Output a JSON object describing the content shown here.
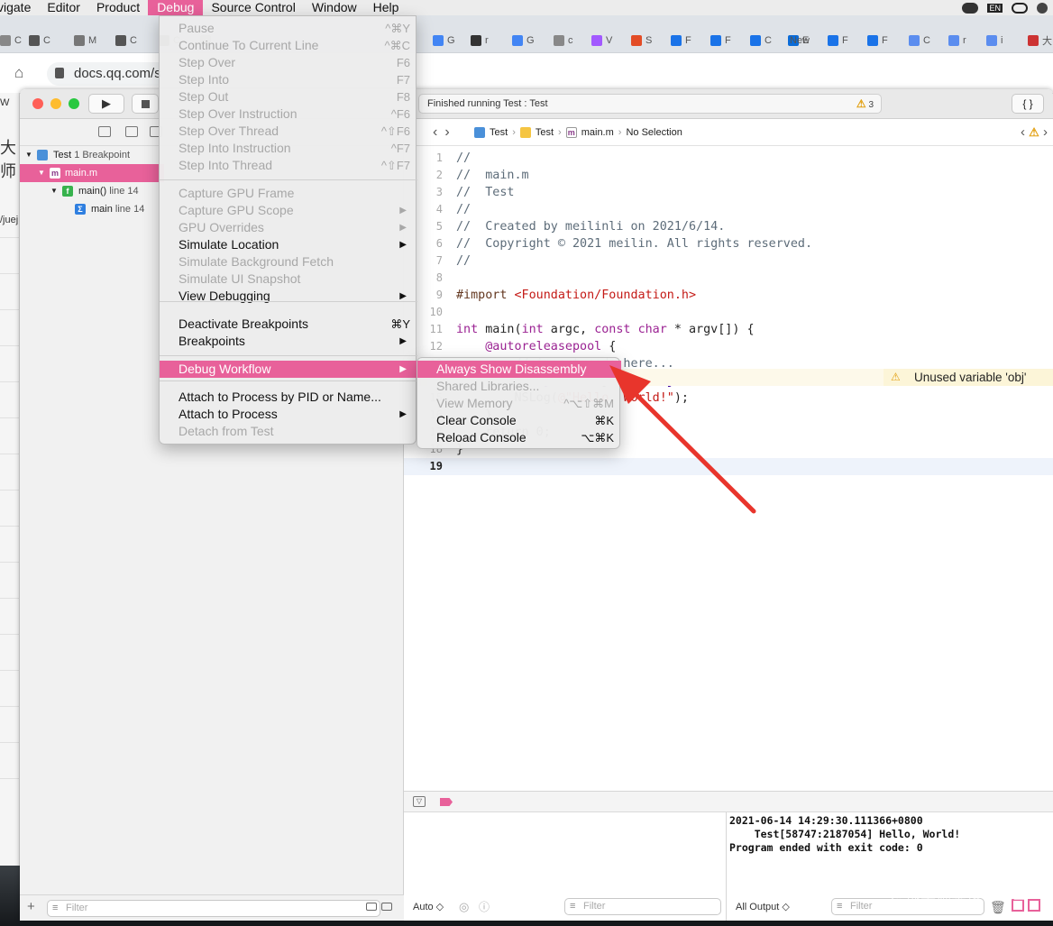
{
  "menubar": {
    "items": [
      "vigate",
      "Editor",
      "Product",
      "Debug",
      "Source Control",
      "Window",
      "Help"
    ],
    "active": "Debug",
    "right_icons": [
      "wechat-icon",
      "input-source-icon",
      "group-icon",
      "apple-icon"
    ],
    "input_source": "EN"
  },
  "browser": {
    "tabs": [
      "C",
      "C",
      "M",
      "C",
      "C",
      "",
      "G",
      "r",
      "G",
      "c",
      "V",
      "S",
      "F",
      "F",
      "C",
      "E",
      "New",
      "F",
      "F",
      "C",
      "r",
      "i",
      "大"
    ],
    "address": "docs.qq.com/s",
    "left_strip": [
      "W",
      "大师",
      "/juej"
    ]
  },
  "xcode": {
    "status": "Finished running Test : Test",
    "warning_count": "3",
    "library_label": "{ }"
  },
  "navigator": {
    "rows": [
      {
        "name": "Test",
        "suffix": "1 Breakpoint"
      },
      {
        "name": "main.m",
        "suffix": ""
      },
      {
        "name": "main()",
        "suffix": "line 14"
      },
      {
        "name": "main",
        "suffix": "line 14"
      }
    ],
    "filter_placeholder": "Filter"
  },
  "jumpbar": {
    "crumbs": [
      "Test",
      "Test",
      "main.m",
      "No Selection"
    ]
  },
  "editor": {
    "lines": [
      {
        "n": "1",
        "segments": [
          {
            "c": "c-com",
            "t": "//"
          }
        ]
      },
      {
        "n": "2",
        "segments": [
          {
            "c": "c-com",
            "t": "//  main.m"
          }
        ]
      },
      {
        "n": "3",
        "segments": [
          {
            "c": "c-com",
            "t": "//  Test"
          }
        ]
      },
      {
        "n": "4",
        "segments": [
          {
            "c": "c-com",
            "t": "//"
          }
        ]
      },
      {
        "n": "5",
        "segments": [
          {
            "c": "c-com",
            "t": "//  Created by meilinli on 2021/6/14."
          }
        ]
      },
      {
        "n": "6",
        "segments": [
          {
            "c": "c-com",
            "t": "//  Copyright © 2021 meilin. All rights reserved."
          }
        ]
      },
      {
        "n": "7",
        "segments": [
          {
            "c": "c-com",
            "t": "//"
          }
        ]
      },
      {
        "n": "8",
        "segments": []
      },
      {
        "n": "9",
        "segments": [
          {
            "c": "c-dir",
            "t": "#import "
          },
          {
            "c": "c-inc",
            "t": "<Foundation/Foundation.h>"
          }
        ]
      },
      {
        "n": "10",
        "segments": []
      },
      {
        "n": "11",
        "segments": [
          {
            "c": "c-key",
            "t": "int"
          },
          {
            "c": "",
            "t": " main("
          },
          {
            "c": "c-key",
            "t": "int"
          },
          {
            "c": "",
            "t": " argc, "
          },
          {
            "c": "c-key",
            "t": "const"
          },
          {
            "c": "",
            "t": " "
          },
          {
            "c": "c-key",
            "t": "char"
          },
          {
            "c": "",
            "t": " * argv[]) {"
          }
        ]
      },
      {
        "n": "12",
        "segments": [
          {
            "c": "",
            "t": "    "
          },
          {
            "c": "c-key",
            "t": "@autoreleasepool"
          },
          {
            "c": "",
            "t": " {"
          }
        ]
      },
      {
        "n": "13",
        "segments": [
          {
            "c": "c-com",
            "t": "        // insert code here..."
          }
        ]
      },
      {
        "n": "14",
        "segments": [
          {
            "c": "",
            "t": "        "
          },
          {
            "c": "c-cls",
            "t": "NSObject"
          },
          {
            "c": "",
            "t": " *obj = ["
          },
          {
            "c": "c-cls",
            "t": "NSObject"
          },
          {
            "c": "",
            "t": " "
          },
          {
            "c": "c-cls",
            "t": "alloc"
          },
          {
            "c": "",
            "t": "];"
          }
        ]
      },
      {
        "n": "15",
        "segments": [
          {
            "c": "",
            "t": "        NSLog("
          },
          {
            "c": "c-str",
            "t": "@\"Hello, World!\""
          },
          {
            "c": "",
            "t": ");"
          }
        ]
      },
      {
        "n": "16",
        "segments": [
          {
            "c": "",
            "t": "    }"
          }
        ]
      },
      {
        "n": "17",
        "segments": [
          {
            "c": "",
            "t": "    return 0;"
          }
        ]
      },
      {
        "n": "18",
        "segments": [
          {
            "c": "",
            "t": "}"
          }
        ]
      },
      {
        "n": "19",
        "segments": []
      }
    ],
    "warning": "Unused variable 'obj'"
  },
  "debug_menu": {
    "items": [
      {
        "label": "Pause",
        "key": "^⌘Y",
        "disabled": true
      },
      {
        "label": "Continue To Current Line",
        "key": "^⌘C",
        "disabled": true
      },
      {
        "label": "Step Over",
        "key": "F6",
        "disabled": true
      },
      {
        "label": "Step Into",
        "key": "F7",
        "disabled": true
      },
      {
        "label": "Step Out",
        "key": "F8",
        "disabled": true
      },
      {
        "label": "Step Over Instruction",
        "key": "^F6",
        "disabled": true
      },
      {
        "label": "Step Over Thread",
        "key": "^⇧F6",
        "disabled": true
      },
      {
        "label": "Step Into Instruction",
        "key": "^F7",
        "disabled": true
      },
      {
        "label": "Step Into Thread",
        "key": "^⇧F7",
        "disabled": true
      },
      {
        "label": "Capture GPU Frame",
        "key": "",
        "disabled": true
      },
      {
        "label": "Capture GPU Scope",
        "key": "▶",
        "disabled": true
      },
      {
        "label": "GPU Overrides",
        "key": "▶",
        "disabled": true
      },
      {
        "label": "Simulate Location",
        "key": "▶",
        "disabled": false
      },
      {
        "label": "Simulate Background Fetch",
        "key": "",
        "disabled": true
      },
      {
        "label": "Simulate UI Snapshot",
        "key": "",
        "disabled": true
      },
      {
        "label": "View Debugging",
        "key": "▶",
        "disabled": false
      },
      {
        "label": "Deactivate Breakpoints",
        "key": "⌘Y",
        "disabled": false
      },
      {
        "label": "Breakpoints",
        "key": "▶",
        "disabled": false
      },
      {
        "label": "Debug Workflow",
        "key": "▶",
        "disabled": false,
        "highlighted": true
      },
      {
        "label": "Attach to Process by PID or Name...",
        "key": "",
        "disabled": false
      },
      {
        "label": "Attach to Process",
        "key": "▶",
        "disabled": false
      },
      {
        "label": "Detach from Test",
        "key": "",
        "disabled": true
      }
    ]
  },
  "workflow_menu": {
    "items": [
      {
        "label": "Always Show Disassembly",
        "key": "",
        "disabled": false,
        "highlighted": true
      },
      {
        "label": "Shared Libraries...",
        "key": "",
        "disabled": true
      },
      {
        "label": "View Memory",
        "key": "^⌥⇧⌘M",
        "disabled": true
      },
      {
        "label": "Clear Console",
        "key": "⌘K",
        "disabled": false
      },
      {
        "label": "Reload Console",
        "key": "⌥⌘K",
        "disabled": false
      }
    ]
  },
  "debug_area": {
    "console_lines": [
      "2021-06-14 14:29:30.111366+0800",
      "    Test[58747:2187054] Hello, World!",
      "Program ended with exit code: 0"
    ],
    "vars_scope": "Auto ◇",
    "console_scope": "All Output ◇",
    "filter_placeholder": "Filter"
  },
  "watermark": "@稀土掘金技术社区",
  "colors": {
    "accent": "#e8619a",
    "warning": "#e2a012",
    "arrow": "#e8352c"
  }
}
